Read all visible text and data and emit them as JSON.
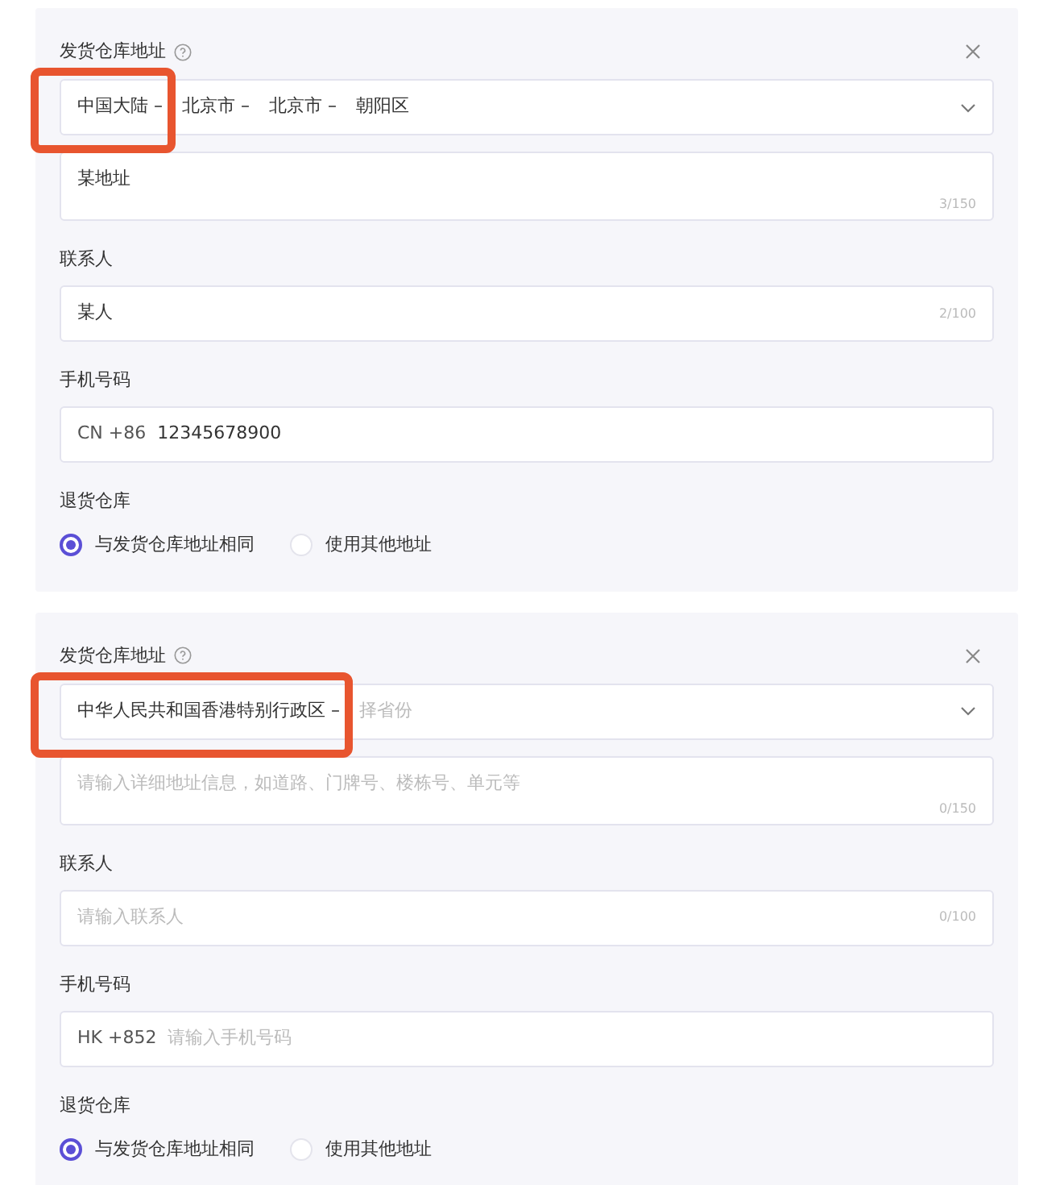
{
  "sections": [
    {
      "address_label": "发货仓库地址",
      "region": {
        "segments": [
          {
            "text": "中国大陆 –",
            "highlighted": true
          },
          {
            "text": "北京市 –",
            "highlighted": false
          },
          {
            "text": "北京市 –",
            "highlighted": false
          },
          {
            "text": "朝阳区",
            "highlighted": false
          }
        ]
      },
      "address": {
        "value": "某地址",
        "counter": "3/150"
      },
      "contact_label": "联系人",
      "contact": {
        "value": "某人",
        "counter": "2/100"
      },
      "phone_label": "手机号码",
      "phone": {
        "code": "CN +86",
        "value": "12345678900"
      },
      "return_label": "退货仓库",
      "options": [
        {
          "label": "与发货仓库地址相同",
          "selected": true
        },
        {
          "label": "使用其他地址",
          "selected": false
        }
      ]
    },
    {
      "address_label": "发货仓库地址",
      "region": {
        "segments": [
          {
            "text": "中华人民共和国香港特别行政区 –",
            "highlighted": true
          }
        ],
        "placeholder": "择省份"
      },
      "address": {
        "placeholder": "请输入详细地址信息，如道路、门牌号、楼栋号、单元等",
        "counter": "0/150"
      },
      "contact_label": "联系人",
      "contact": {
        "placeholder": "请输入联系人",
        "counter": "0/100"
      },
      "phone_label": "手机号码",
      "phone": {
        "code": "HK +852",
        "placeholder": "请输入手机号码"
      },
      "return_label": "退货仓库",
      "options": [
        {
          "label": "与发货仓库地址相同",
          "selected": true
        },
        {
          "label": "使用其他地址",
          "selected": false
        }
      ]
    }
  ]
}
